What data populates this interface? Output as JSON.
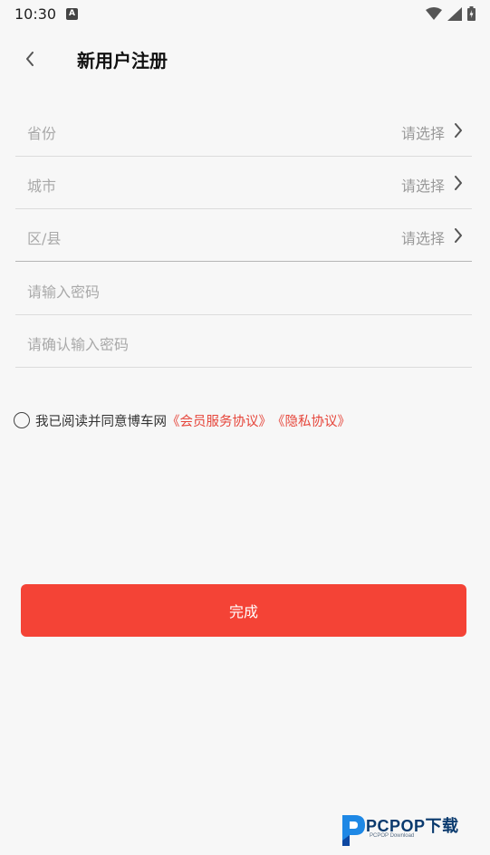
{
  "status_bar": {
    "time": "10:30",
    "notification_icon": "A"
  },
  "header": {
    "back_icon": "chevron-left",
    "title": "新用户注册"
  },
  "form": {
    "province": {
      "label": "省份",
      "value": "请选择"
    },
    "city": {
      "label": "城市",
      "value": "请选择"
    },
    "district": {
      "label": "区/县",
      "value": "请选择"
    },
    "password_placeholder": "请输入密码",
    "confirm_password_placeholder": "请确认输入密码"
  },
  "agreement": {
    "text": "我已阅读并同意博车网",
    "member_link": "《会员服务协议》",
    "privacy_link": "《隐私协议》"
  },
  "submit_label": "完成",
  "watermark": {
    "brand": "PCPOP下载",
    "sub": "PCPOP Download"
  },
  "colors": {
    "accent": "#f44336",
    "link": "#e6463b",
    "background": "#f7f7f7"
  }
}
